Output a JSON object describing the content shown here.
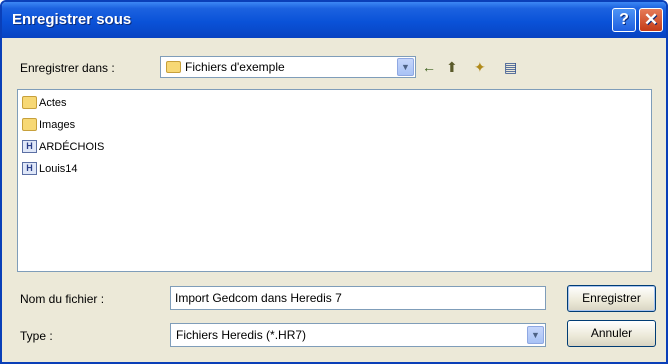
{
  "window": {
    "title": "Enregistrer sous",
    "help_glyph": "?",
    "close_glyph": "✕"
  },
  "toolbar": {
    "location_label": "Enregistrer dans :",
    "location_value": "Fichiers d'exemple",
    "back_glyph": "←",
    "up_glyph": "⬆",
    "newfolder_glyph": "✦",
    "views_glyph": "▤"
  },
  "files": [
    {
      "name": "Actes",
      "type": "folder"
    },
    {
      "name": "Images",
      "type": "folder"
    },
    {
      "name": "ARDÉCHOIS",
      "type": "heredis"
    },
    {
      "name": "Louis14",
      "type": "heredis"
    }
  ],
  "form": {
    "filename_label": "Nom du fichier :",
    "filename_value": "Import Gedcom dans Heredis 7",
    "type_label": "Type :",
    "type_value": "Fichiers Heredis (*.HR7)"
  },
  "buttons": {
    "save": "Enregistrer",
    "cancel": "Annuler"
  },
  "icons": {
    "heredis_letter": "H"
  }
}
